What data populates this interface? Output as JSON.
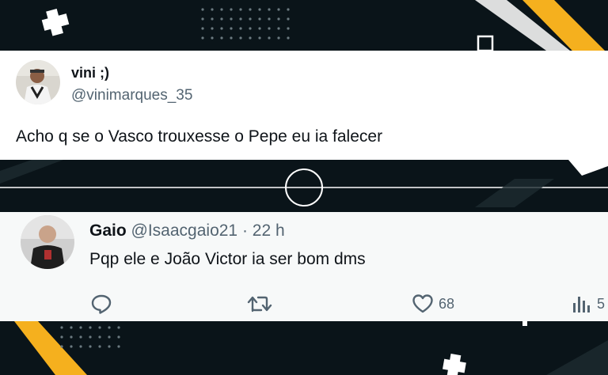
{
  "colors": {
    "accent": "#f5b01e",
    "background": "#0a1419"
  },
  "tweet": {
    "display_name": "vini ;)",
    "handle": "@vinimarques_35",
    "text": "Acho q se o Vasco trouxesse o Pepe eu ia falecer"
  },
  "reply": {
    "display_name": "Gaio",
    "handle": "@Isaacgaio21",
    "separator": "·",
    "time": "22 h",
    "text": "Pqp ele e João Victor ia ser bom dms",
    "actions": {
      "reply_icon": "reply-icon",
      "retweet_icon": "retweet-icon",
      "like_icon": "heart-icon",
      "like_count": "68",
      "views_icon": "views-icon",
      "views_count": "5"
    }
  }
}
